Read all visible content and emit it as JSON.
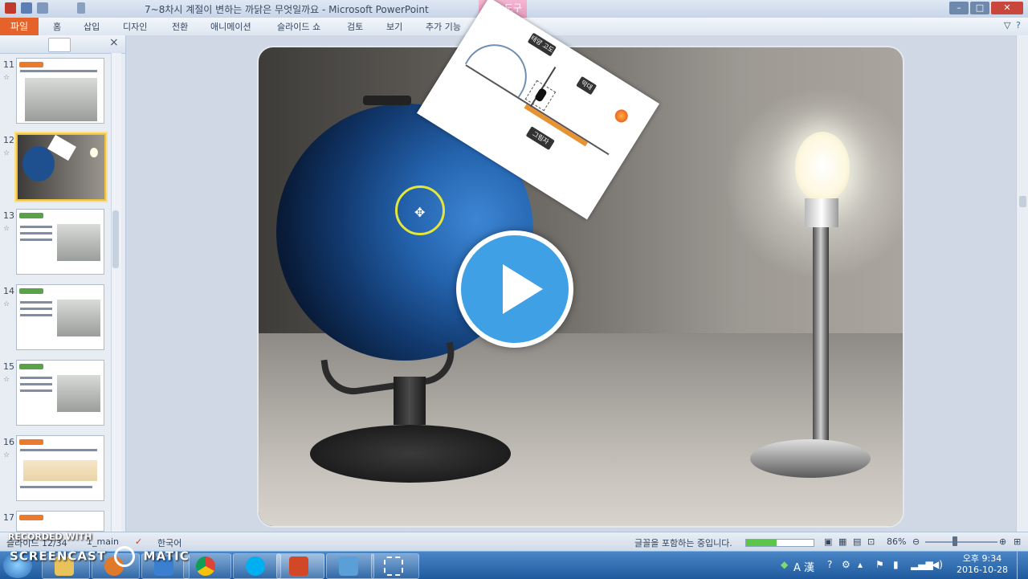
{
  "window": {
    "title": "7~8차시 계절이 변하는 까닭은 무엇일까요 - Microsoft PowerPoint",
    "contextual_tab_group": "그림 도구"
  },
  "ribbon": {
    "file": "파일",
    "tabs": [
      "홈",
      "삽입",
      "디자인",
      "전환",
      "애니메이션",
      "슬라이드 쇼",
      "검토",
      "보기",
      "추가 기능"
    ],
    "format_tab": "서식"
  },
  "slides_panel": {
    "slide_numbers": [
      "11",
      "12",
      "13",
      "14",
      "15",
      "16",
      "17"
    ],
    "selected": "12"
  },
  "slide": {
    "diagram_labels": [
      "태양 고도",
      "그림자",
      "막대"
    ]
  },
  "status_bar": {
    "slide_info": "슬라이드 12/34",
    "theme": "1_main",
    "language": "한국어",
    "message": "글꼴을 포함하는 중입니다.",
    "zoom": "86%",
    "progress": 0.45
  },
  "taskbar": {
    "time": "오후 9:34",
    "date": "2016-10-28",
    "ime": "A 漢"
  },
  "watermark": {
    "line1": "RECORDED WITH",
    "line2": "SCREENCAST",
    "line3": "MATIC"
  },
  "colors": {
    "accent_file_tab": "#e5632a",
    "play_button": "#3fa0e6",
    "taskbar": "#1f5a9e"
  }
}
